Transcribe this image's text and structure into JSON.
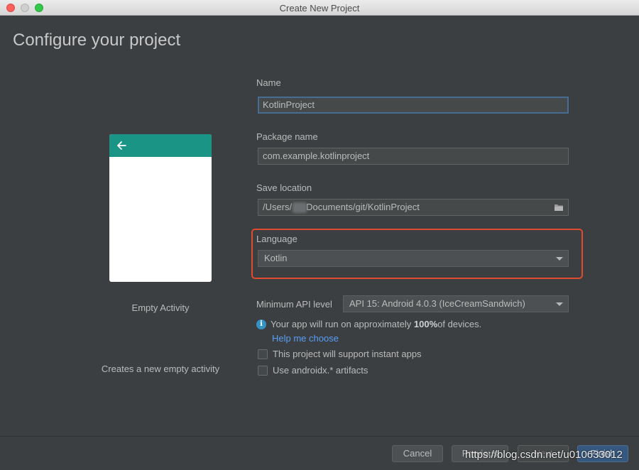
{
  "window": {
    "title": "Create New Project"
  },
  "page": {
    "title": "Configure your project"
  },
  "preview": {
    "template_name": "Empty Activity",
    "template_description": "Creates a new empty activity",
    "toolbar_color": "#1a9585",
    "back_icon": "arrow-left-icon"
  },
  "form": {
    "name_label": "Name",
    "name_value": "KotlinProject",
    "package_label": "Package name",
    "package_value": "com.example.kotlinproject",
    "location_label": "Save location",
    "location_value_prefix": "/Users/",
    "location_value_suffix": "Documents/git/KotlinProject",
    "folder_icon": "folder-icon",
    "language_label": "Language",
    "language_value": "Kotlin",
    "min_api_label": "Minimum API level",
    "min_api_value": "API 15: Android 4.0.3 (IceCreamSandwich)",
    "info_prefix": "Your app will run on approximately ",
    "info_percent": "100%",
    "info_suffix": " of devices.",
    "help_link": "Help me choose",
    "instant_apps_label": "This project will support instant apps",
    "androidx_label": "Use androidx.* artifacts"
  },
  "buttons": {
    "cancel": "Cancel",
    "previous": "Previous",
    "next": "Next",
    "finish": "Finish"
  },
  "watermark": "https://blog.csdn.net/u010633012",
  "colors": {
    "highlight": "#e04a2f",
    "link": "#589df6",
    "primary": "#365880"
  }
}
